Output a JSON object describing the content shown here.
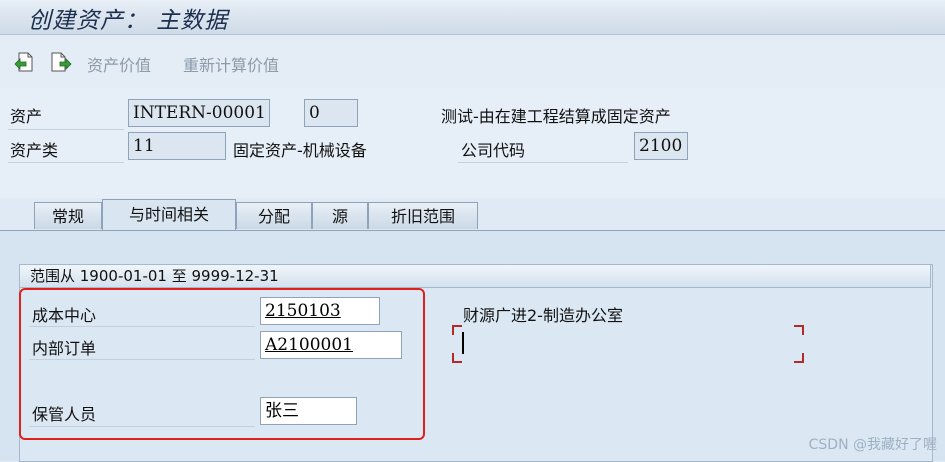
{
  "window": {
    "title": "创建资产： 主数据"
  },
  "toolbar": {
    "btn_asset_value": "资产价值",
    "btn_recalc_value": "重新计算价值"
  },
  "header": {
    "asset_label": "资产",
    "asset_number": "INTERN-00001",
    "sub_number": "0",
    "asset_description": "测试-由在建工程结算成固定资产",
    "asset_class_label": "资产类",
    "asset_class": "11",
    "asset_class_desc": "固定资产-机械设备",
    "company_code_label": "公司代码",
    "company_code": "2100"
  },
  "tabs": [
    {
      "label": "常规"
    },
    {
      "label": "与时间相关"
    },
    {
      "label": "分配"
    },
    {
      "label": "源"
    },
    {
      "label": "折旧范围"
    }
  ],
  "time_group": {
    "title": "范围从 1900-01-01 至 9999-12-31",
    "cost_center_label": "成本中心",
    "cost_center": "2150103",
    "cost_center_desc": "财源广进2-制造办公室",
    "internal_order_label": "内部订单",
    "internal_order": "A2100001",
    "custodian_label": "保管人员",
    "custodian": "张三"
  },
  "watermark": "CSDN @我藏好了喔"
}
